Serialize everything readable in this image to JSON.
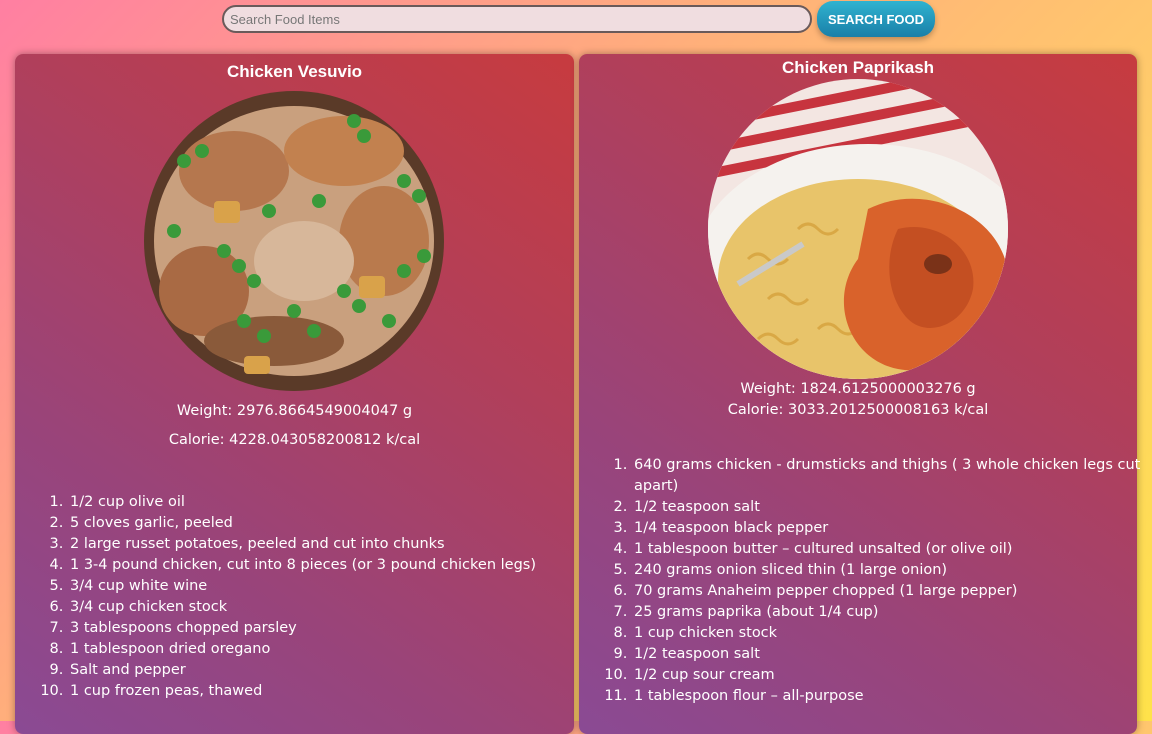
{
  "search": {
    "placeholder": "Search Food Items",
    "button_label": "SEARCH FOOD"
  },
  "recipes": [
    {
      "title": "Chicken Vesuvio",
      "image_icon": "chicken-vesuvio-photo",
      "weight": "Weight: 2976.8664549004047 g",
      "calorie": "Calorie: 4228.043058200812 k/cal",
      "ingredients": [
        "1/2 cup olive oil",
        "5 cloves garlic, peeled",
        "2 large russet potatoes, peeled and cut into chunks",
        "1 3-4 pound chicken, cut into 8 pieces (or 3 pound chicken legs)",
        "3/4 cup white wine",
        "3/4 cup chicken stock",
        "3 tablespoons chopped parsley",
        "1 tablespoon dried oregano",
        "Salt and pepper",
        "1 cup frozen peas, thawed"
      ]
    },
    {
      "title": "Chicken Paprikash",
      "image_icon": "chicken-paprikash-photo",
      "weight": "Weight: 1824.6125000003276 g",
      "calorie": "Calorie: 3033.2012500008163 k/cal",
      "ingredients": [
        "640 grams chicken - drumsticks and thighs ( 3 whole chicken legs cut apart)",
        "1/2 teaspoon salt",
        "1/4 teaspoon black pepper",
        "1 tablespoon butter – cultured unsalted (or olive oil)",
        "240 grams onion sliced thin (1 large onion)",
        "70 grams Anaheim pepper chopped (1 large pepper)",
        "25 grams paprika (about 1/4 cup)",
        "1 cup chicken stock",
        "1/2 teaspoon salt",
        "1/2 cup sour cream",
        "1 tablespoon flour – all-purpose"
      ]
    }
  ]
}
